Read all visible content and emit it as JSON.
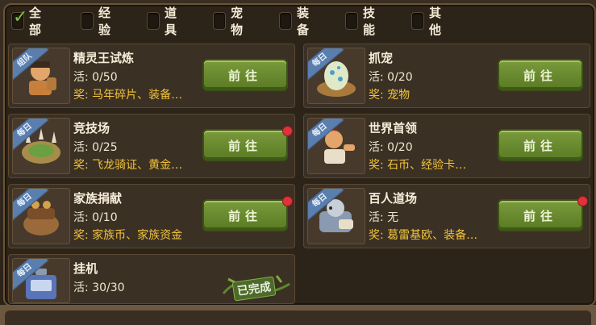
{
  "filters": [
    {
      "label": "全部",
      "checked": true
    },
    {
      "label": "经验",
      "checked": false
    },
    {
      "label": "道具",
      "checked": false
    },
    {
      "label": "宠物",
      "checked": false
    },
    {
      "label": "装备",
      "checked": false
    },
    {
      "label": "技能",
      "checked": false
    },
    {
      "label": "其他",
      "checked": false
    }
  ],
  "quests": [
    {
      "tag": "组队",
      "title": "精灵王试炼",
      "activity": "活: 0/50",
      "reward_key": "奖:",
      "reward": "马年碎片、装备…",
      "button": "前往",
      "has_alert": false,
      "completed": false,
      "icon": "caveman-icon"
    },
    {
      "tag": "每日",
      "title": "抓宠",
      "activity": "活: 0/20",
      "reward_key": "奖:",
      "reward": "宠物",
      "button": "前往",
      "has_alert": false,
      "completed": false,
      "icon": "egg-nest-icon"
    },
    {
      "tag": "每日",
      "title": "竞技场",
      "activity": "活: 0/25",
      "reward_key": "奖:",
      "reward": "飞龙骑证、黄金…",
      "button": "前往",
      "has_alert": true,
      "completed": false,
      "icon": "arena-icon"
    },
    {
      "tag": "每日",
      "title": "世界首领",
      "activity": "活: 0/20",
      "reward_key": "奖:",
      "reward": "石币、经验卡…",
      "button": "前往",
      "has_alert": false,
      "completed": false,
      "icon": "warrior-icon"
    },
    {
      "tag": "每日",
      "title": "家族捐献",
      "activity": "活: 0/10",
      "reward_key": "奖:",
      "reward": "家族币、家族资金",
      "button": "前往",
      "has_alert": true,
      "completed": false,
      "icon": "donation-pot-icon"
    },
    {
      "tag": "每日",
      "title": "百人道场",
      "activity": "活: 无",
      "reward_key": "奖:",
      "reward": "葛雷基欧、装备…",
      "button": "前往",
      "has_alert": true,
      "completed": false,
      "icon": "armored-beast-icon"
    },
    {
      "tag": "每日",
      "title": "挂机",
      "activity": "活: 30/30",
      "reward_key": "",
      "reward": "",
      "button": "",
      "has_alert": false,
      "completed": true,
      "completed_label": "已完成",
      "icon": "idle-machine-icon"
    }
  ],
  "colors": {
    "reward": "#f0c33c",
    "button": "#6a8a30",
    "alert": "#e0323a",
    "check": "#7ec23a"
  }
}
